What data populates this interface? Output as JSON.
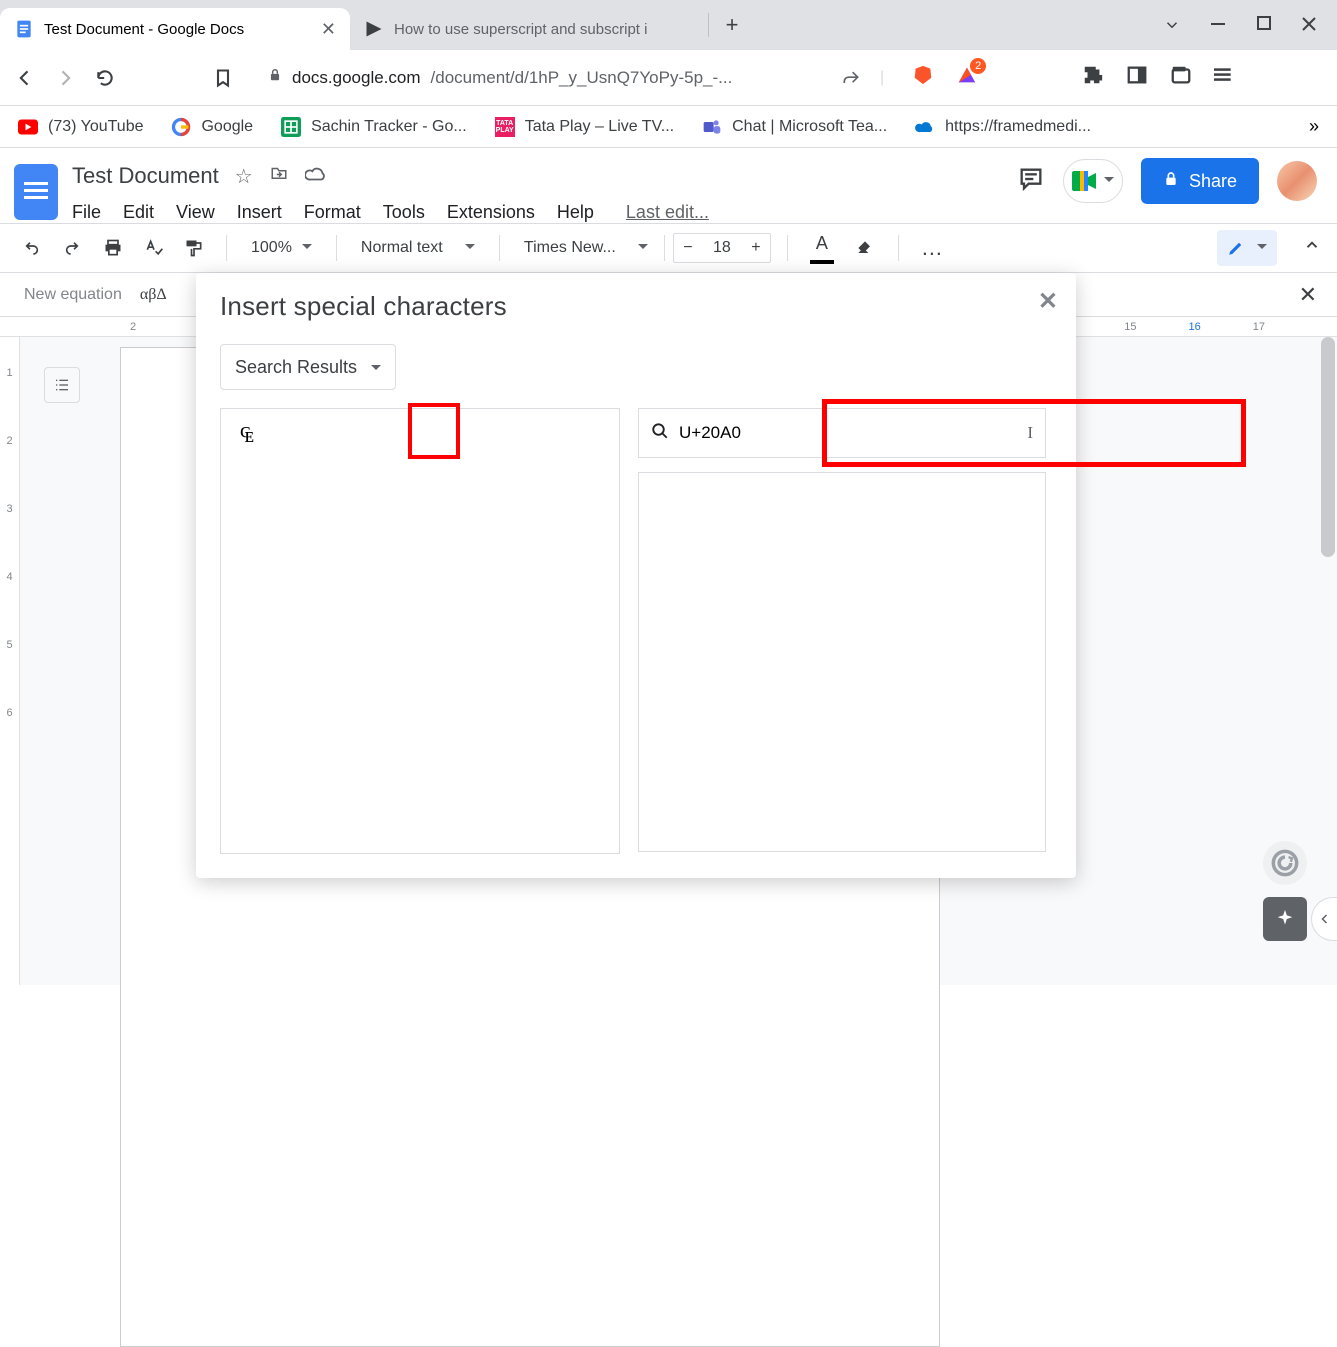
{
  "browser": {
    "tabs": [
      {
        "title": "Test Document - Google Docs",
        "active": true
      },
      {
        "title": "How to use superscript and subscript i",
        "active": false
      }
    ],
    "url_host": "docs.google.com",
    "url_path": "/document/d/1hP_y_UsnQ7YoPy-5p_-...",
    "badge_count": "2"
  },
  "bookmarks": [
    {
      "label": "(73) YouTube"
    },
    {
      "label": "Google"
    },
    {
      "label": "Sachin Tracker - Go..."
    },
    {
      "label": "Tata Play – Live TV..."
    },
    {
      "label": "Chat | Microsoft Tea..."
    },
    {
      "label": "https://framedmedi..."
    }
  ],
  "docs": {
    "doc_title": "Test Document",
    "menus": [
      "File",
      "Edit",
      "View",
      "Insert",
      "Format",
      "Tools",
      "Extensions",
      "Help"
    ],
    "last_edit": "Last edit...",
    "share_label": "Share"
  },
  "toolbar": {
    "zoom": "100%",
    "style": "Normal text",
    "font": "Times New...",
    "font_size": "18"
  },
  "equation_bar": {
    "label": "New equation",
    "groups": "αβΔ"
  },
  "ruler_top": [
    "2"
  ],
  "ruler_top_right": [
    "15",
    "16",
    "17"
  ],
  "ruler_left": [
    "1",
    "2",
    "3",
    "4",
    "5",
    "6"
  ],
  "dialog": {
    "title": "Insert special characters",
    "dropdown": "Search Results",
    "result_char": "₠",
    "search_value": "U+20A0"
  }
}
